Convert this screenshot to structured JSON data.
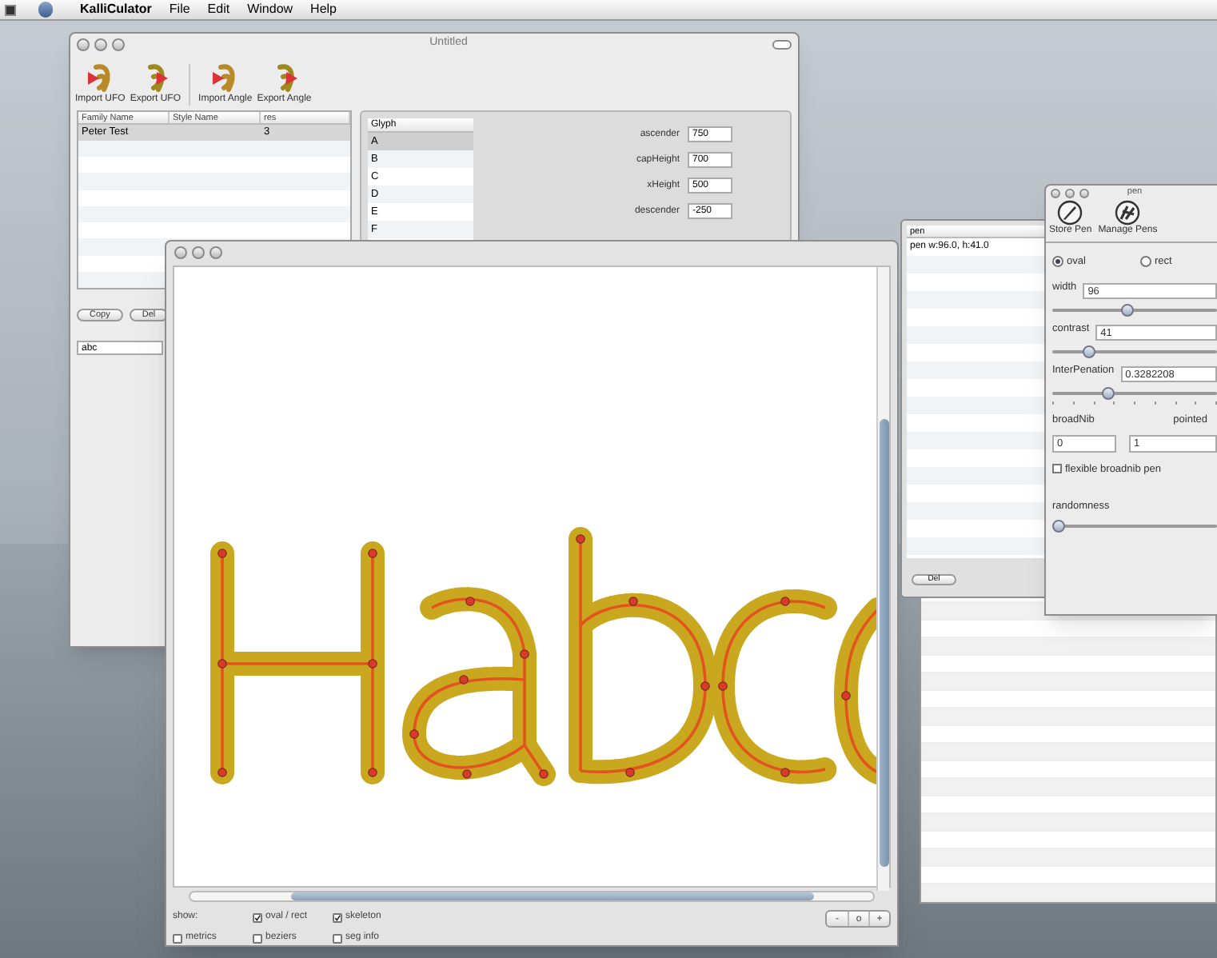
{
  "menu_bar": {
    "app": "KalliCulator",
    "items": [
      "File",
      "Edit",
      "Window",
      "Help"
    ]
  },
  "main_window": {
    "title": "Untitled",
    "toolbar": [
      {
        "label": "Import UFO",
        "kind": "import"
      },
      {
        "label": "Export UFO",
        "kind": "export"
      },
      {
        "label": "Import Angle",
        "kind": "import"
      },
      {
        "label": "Export Angle",
        "kind": "export"
      }
    ],
    "fonts_table": {
      "columns": [
        "Family Name",
        "Style Name",
        "res"
      ],
      "rows": [
        {
          "family_name": "Peter Test",
          "res": "3",
          "selected": true
        }
      ]
    },
    "buttons": [
      "Copy",
      "Del"
    ],
    "text_field": {
      "value": "abc"
    },
    "glyph_list": {
      "column": "Glyph",
      "rows": [
        {
          "label": "A",
          "selected": true
        },
        {
          "label": "B",
          "selected": false
        },
        {
          "label": "C",
          "selected": false
        },
        {
          "label": "D",
          "selected": false
        },
        {
          "label": "E",
          "selected": false
        },
        {
          "label": "F",
          "selected": false
        }
      ]
    },
    "metrics": [
      {
        "label": "ascender",
        "value": "750"
      },
      {
        "label": "capHeight",
        "value": "700"
      },
      {
        "label": "xHeight",
        "value": "500"
      },
      {
        "label": "descender",
        "value": "-250"
      }
    ]
  },
  "editor_window": {
    "show_label": "show:",
    "options": [
      {
        "label": "oval / rect",
        "checked": true
      },
      {
        "label": "skeleton",
        "checked": true
      },
      {
        "label": "metrics",
        "checked": false
      },
      {
        "label": "beziers",
        "checked": false
      },
      {
        "label": "seg info",
        "checked": false
      }
    ],
    "zoom_buttons": [
      "-",
      "o",
      "+"
    ]
  },
  "pen_list_window": {
    "column": "pen",
    "rows": [
      {
        "label": "pen w:96.0, h:41.0"
      }
    ],
    "button": "Del"
  },
  "pen_window": {
    "title": "pen",
    "toolbar": [
      {
        "label": "Store Pen",
        "kind": "store"
      },
      {
        "label": "Manage Pens",
        "kind": "manage"
      }
    ],
    "shape": [
      {
        "label": "oval",
        "selected": true
      },
      {
        "label": "rect",
        "selected": false
      }
    ],
    "sliders": [
      {
        "label": "width",
        "value": "96",
        "level": 0.45
      },
      {
        "label": "contrast",
        "value": "41",
        "level": 0.2
      },
      {
        "label": "InterPenation",
        "value": "0.3282208",
        "level": 0.33,
        "ticks": true
      }
    ],
    "broadnib": {
      "label": "broadNib",
      "value": "0"
    },
    "pointed": {
      "label": "pointed",
      "value": "1"
    },
    "flexible": {
      "label": "flexible broadnib pen",
      "checked": false
    },
    "randomness": {
      "label": "randomness",
      "level": 0.0
    }
  }
}
